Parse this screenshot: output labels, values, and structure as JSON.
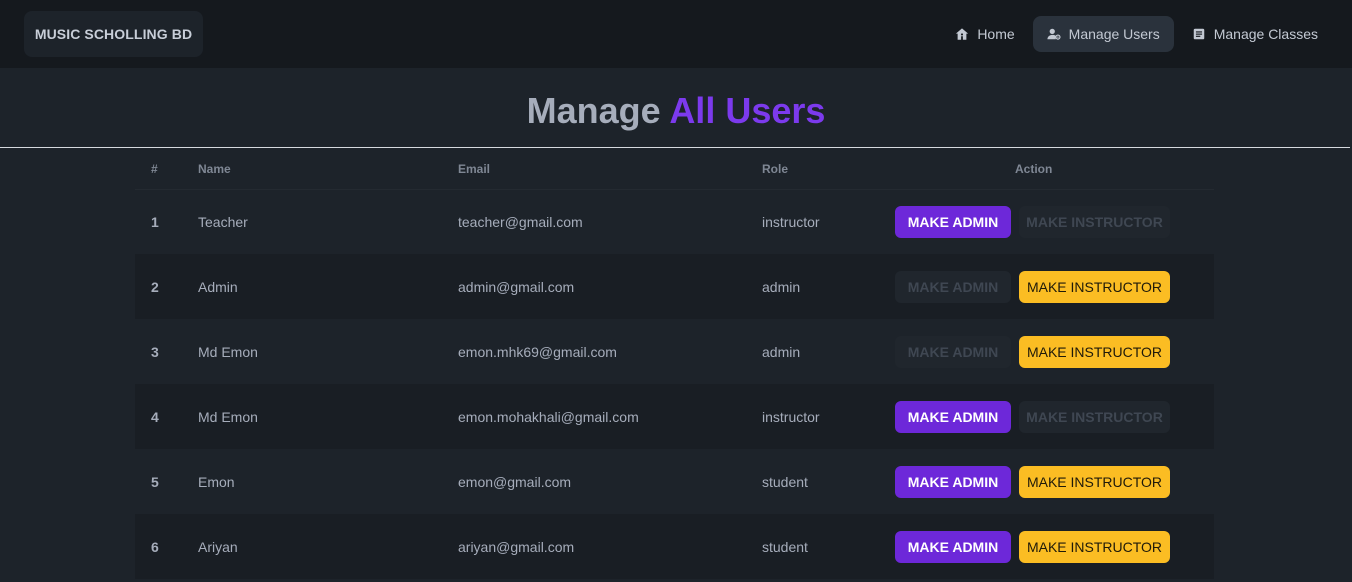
{
  "navbar": {
    "brand": "MUSIC SCHOLLING BD",
    "items": [
      {
        "label": "Home",
        "icon": "home-icon",
        "active": false
      },
      {
        "label": "Manage Users",
        "icon": "user-gear-icon",
        "active": true
      },
      {
        "label": "Manage Classes",
        "icon": "classes-icon",
        "active": false
      }
    ]
  },
  "page": {
    "title_part1": "Manage",
    "title_part2": "All Users",
    "accent_color": "#7c3aed"
  },
  "table": {
    "columns": [
      "#",
      "Name",
      "Email",
      "Role",
      "Action"
    ],
    "rows": [
      {
        "num": "1",
        "name": "Teacher",
        "email": "teacher@gmail.com",
        "role": "instructor",
        "admin_enabled": true,
        "instructor_enabled": false
      },
      {
        "num": "2",
        "name": "Admin",
        "email": "admin@gmail.com",
        "role": "admin",
        "admin_enabled": false,
        "instructor_enabled": true
      },
      {
        "num": "3",
        "name": "Md Emon",
        "email": "emon.mhk69@gmail.com",
        "role": "admin",
        "admin_enabled": false,
        "instructor_enabled": true
      },
      {
        "num": "4",
        "name": "Md Emon",
        "email": "emon.mohakhali@gmail.com",
        "role": "instructor",
        "admin_enabled": true,
        "instructor_enabled": false
      },
      {
        "num": "5",
        "name": "Emon",
        "email": "emon@gmail.com",
        "role": "student",
        "admin_enabled": true,
        "instructor_enabled": true
      },
      {
        "num": "6",
        "name": "Ariyan",
        "email": "ariyan@gmail.com",
        "role": "student",
        "admin_enabled": true,
        "instructor_enabled": true
      }
    ],
    "make_admin_label": "MAKE ADMIN",
    "make_instructor_label": "MAKE INSTRUCTOR"
  },
  "colors": {
    "admin_button": "#6d28d9",
    "instructor_button": "#fbbd23"
  }
}
